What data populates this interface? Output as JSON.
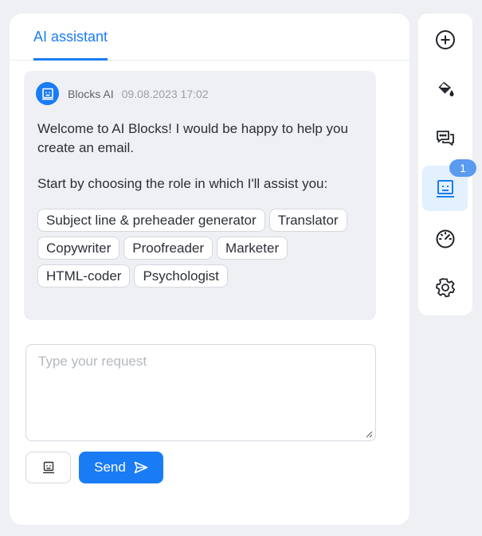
{
  "panel": {
    "tab_label": "AI assistant"
  },
  "message": {
    "sender": "Blocks AI",
    "timestamp": "09.08.2023 17:02",
    "text_1": "Welcome to AI Blocks! I would be happy to help you create an email.",
    "text_2": "Start by choosing the role in which I'll assist you:",
    "roles": [
      "Subject line & preheader generator",
      "Translator",
      "Copywriter",
      "Proofreader",
      "Marketer",
      "HTML-coder",
      "Psychologist"
    ]
  },
  "input": {
    "placeholder": "Type your request"
  },
  "actions": {
    "send_label": "Send"
  },
  "toolbar": {
    "items": [
      {
        "icon": "plus-circle-icon"
      },
      {
        "icon": "paint-bucket-icon"
      },
      {
        "icon": "chat-bubbles-icon"
      },
      {
        "icon": "ai-robot-icon",
        "active": true
      },
      {
        "icon": "gauge-icon"
      },
      {
        "icon": "gear-icon"
      }
    ],
    "badge_count": "1"
  },
  "colors": {
    "accent": "#1a7cf5",
    "background": "#eef0f4",
    "active_tool_bg": "#e3f0fd",
    "badge": "#5a9bf0"
  }
}
